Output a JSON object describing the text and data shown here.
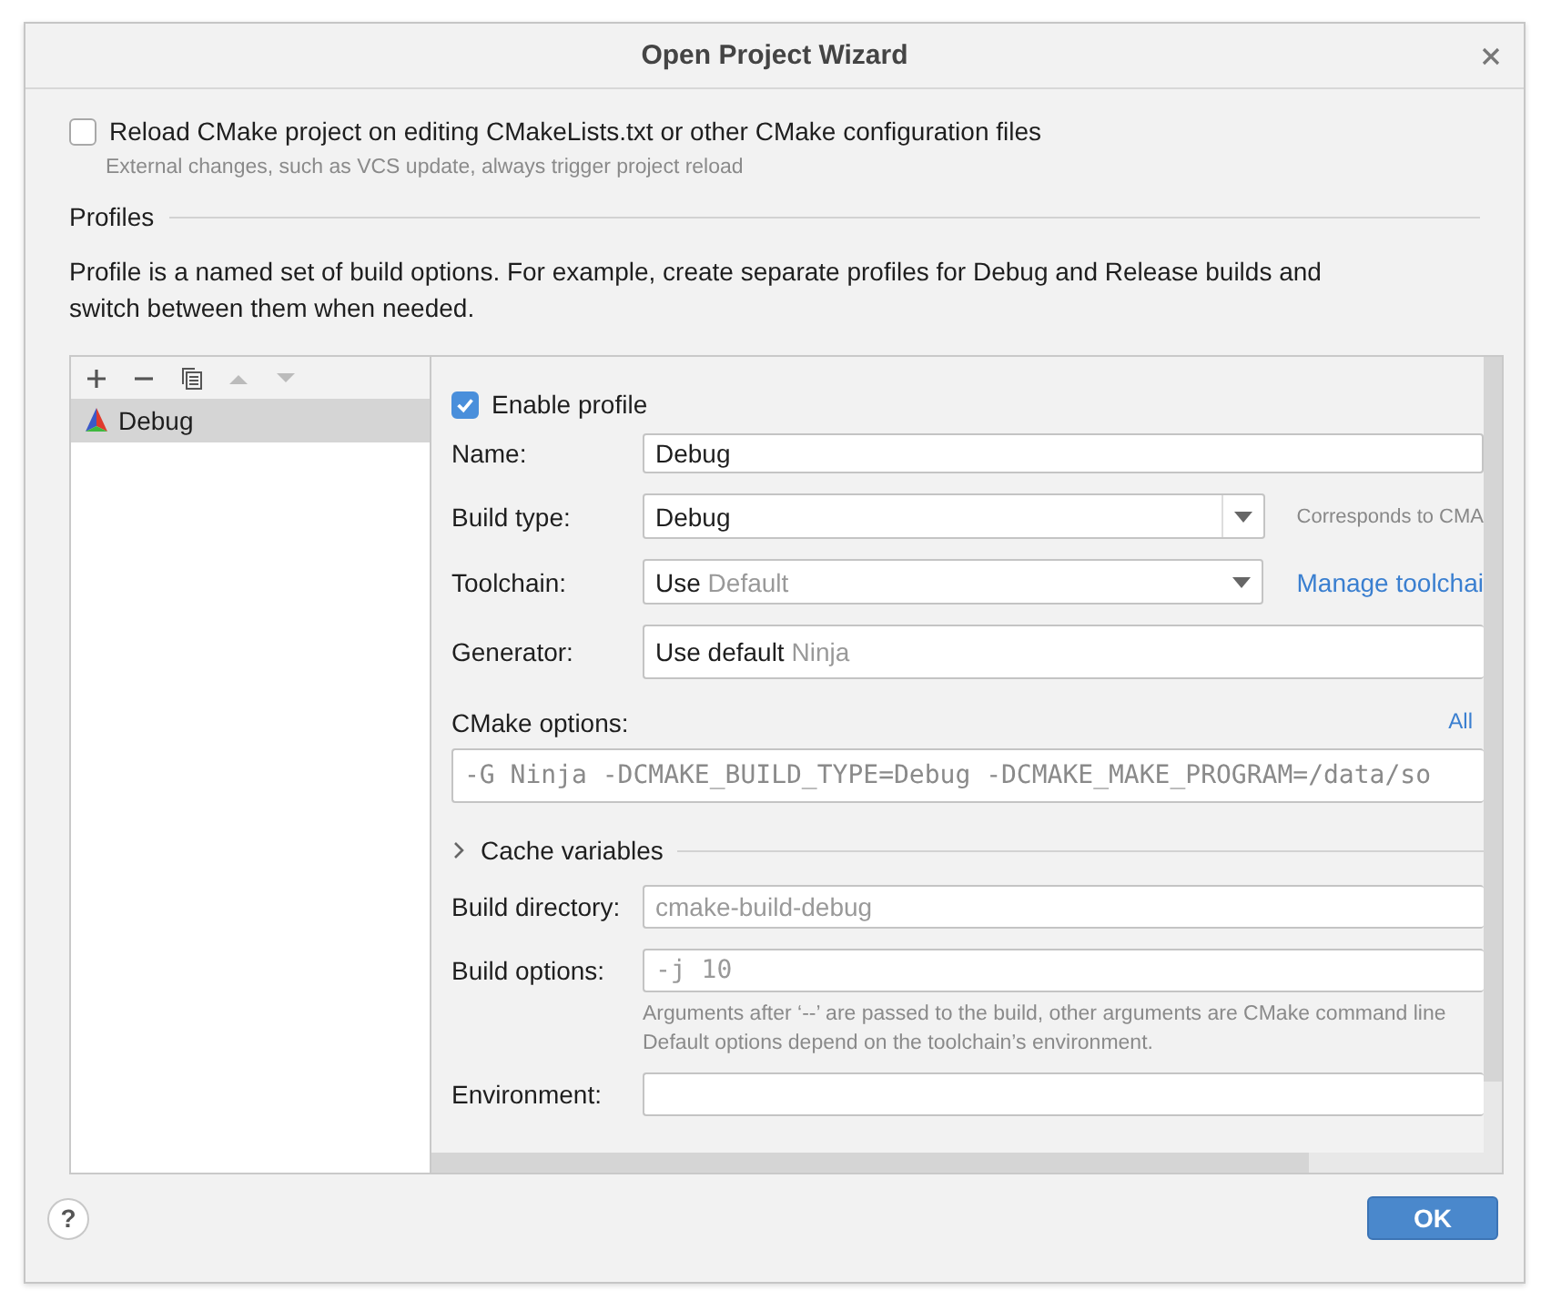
{
  "window": {
    "title": "Open Project Wizard"
  },
  "reload": {
    "label": "Reload CMake project on editing CMakeLists.txt or other CMake configuration files",
    "checked": false,
    "hint": "External changes, such as VCS update, always trigger project reload"
  },
  "profiles": {
    "heading": "Profiles",
    "description": "Profile is a named set of build options. For example, create separate profiles for Debug and Release builds and switch between them when needed."
  },
  "profile_list": {
    "items": [
      {
        "name": "Debug",
        "selected": true
      }
    ]
  },
  "profile": {
    "enabled": true,
    "enable_label": "Enable profile",
    "name": {
      "label": "Name:",
      "value": "Debug"
    },
    "build_type": {
      "label": "Build type:",
      "value": "Debug",
      "note": "Corresponds to CMA"
    },
    "toolchain": {
      "label": "Toolchain:",
      "value": "Use",
      "hint": "Default",
      "link": "Manage toolchai"
    },
    "generator": {
      "label": "Generator:",
      "value": "Use default",
      "hint": "Ninja"
    },
    "cmake_options": {
      "label": "CMake options:",
      "link": "All",
      "placeholder": "-G Ninja -DCMAKE_BUILD_TYPE=Debug -DCMAKE_MAKE_PROGRAM=/data/so"
    },
    "cache_variables": {
      "label": "Cache variables",
      "expanded": false
    },
    "build_directory": {
      "label": "Build directory:",
      "placeholder": "cmake-build-debug"
    },
    "build_options": {
      "label": "Build options:",
      "placeholder": "-j 10",
      "hint": [
        "Arguments after ‘--’ are passed to the build, other arguments are CMake command line",
        "Default options depend on the toolchain’s environment."
      ]
    },
    "environment": {
      "label": "Environment:"
    }
  },
  "buttons": {
    "help": "?",
    "ok": "OK"
  }
}
